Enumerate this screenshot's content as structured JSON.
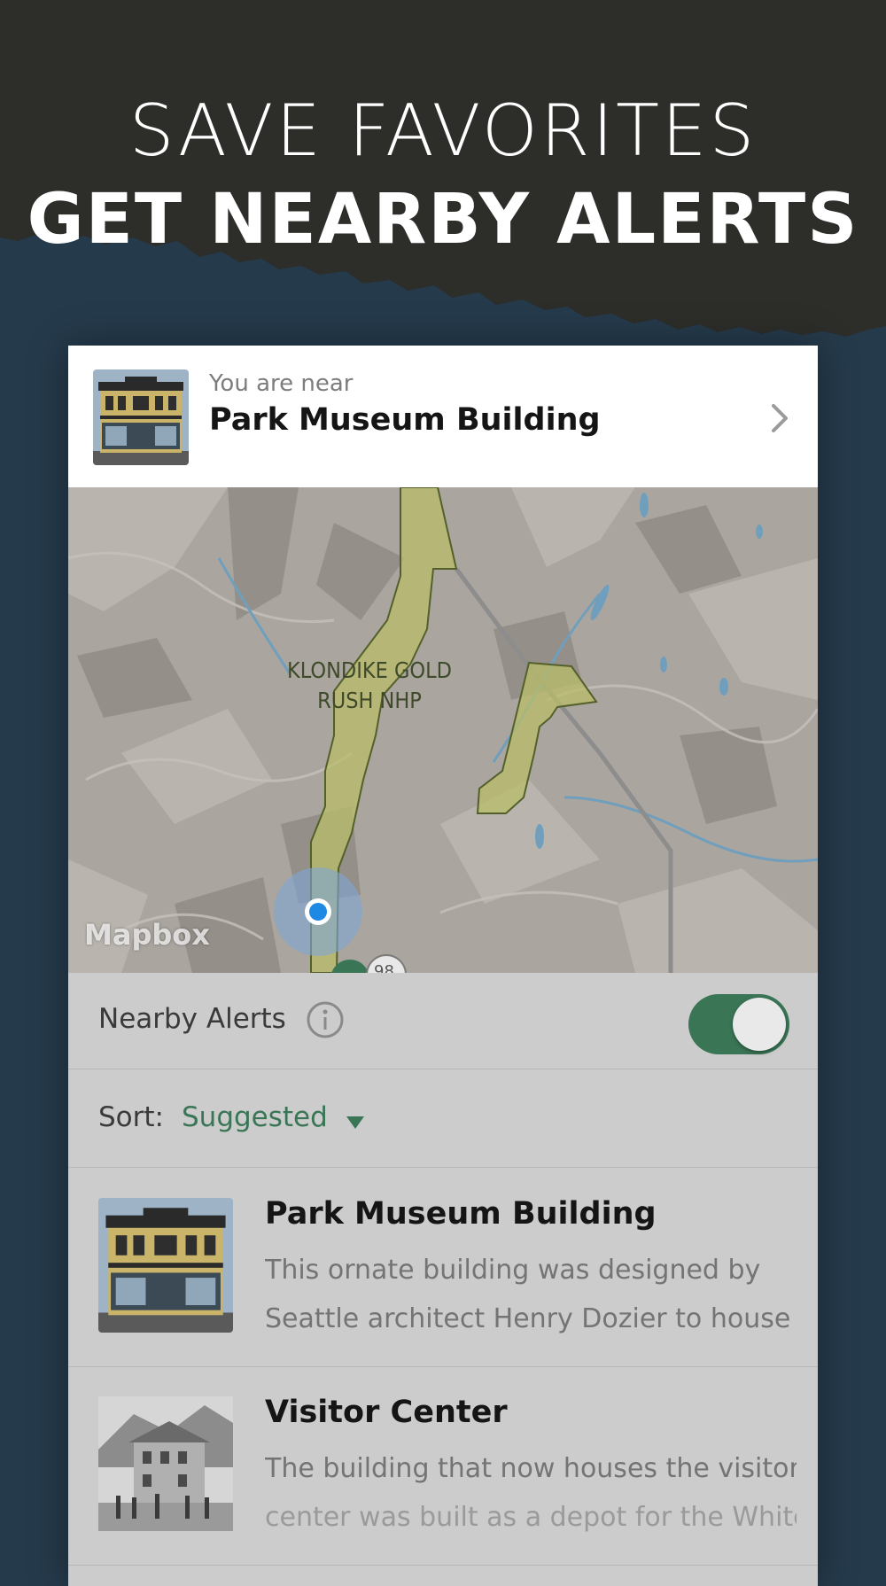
{
  "hero": {
    "line1": "SAVE FAVORITES",
    "line2": "GET NEARBY ALERTS"
  },
  "near": {
    "subtitle": "You are near",
    "title": "Park Museum Building"
  },
  "map": {
    "label_line1": "KLONDIKE GOLD",
    "label_line2": "RUSH NHP",
    "attribution": "Mapbox",
    "route_shield": "98"
  },
  "alerts": {
    "label": "Nearby Alerts",
    "enabled": true
  },
  "sort": {
    "label": "Sort:",
    "value": "Suggested"
  },
  "items": [
    {
      "title": "Park Museum Building",
      "desc_line1": "This ornate building was designed by",
      "desc_line2": "Seattle architect Henry Dozier to house"
    },
    {
      "title": "Visitor Center",
      "desc_line1": "The building that now houses the visitor",
      "desc_line2": "center was built as a depot for the White"
    }
  ],
  "colors": {
    "accent": "#3a7656",
    "hero_dark": "#2d2d2a",
    "background": "#253a4b",
    "park_fill": "#b9bd6a",
    "location_dot": "#1e88e5"
  }
}
